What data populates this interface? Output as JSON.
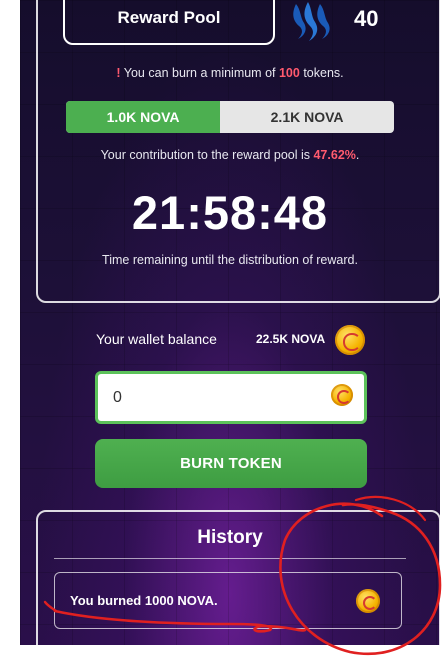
{
  "reward_pool": {
    "label": "Reward Pool",
    "count": "40"
  },
  "minimum_note": {
    "prefix": "!",
    "before": " You can burn a minimum of ",
    "amount": "100",
    "after": " tokens."
  },
  "split": {
    "left_label": "1.0K NOVA",
    "right_label": "2.1K NOVA",
    "left_fraction": 0.47
  },
  "contribution": {
    "text": "Your contribution to the reward pool is ",
    "percent": "47.62%",
    "suffix": "."
  },
  "timer": {
    "value": "21:58:48",
    "label": "Time remaining until the distribution of reward."
  },
  "wallet": {
    "label": "Your wallet balance",
    "value": "22.5K NOVA",
    "icon": "nova-coin-icon"
  },
  "input": {
    "value": "0"
  },
  "burn_button": {
    "label": "BURN TOKEN"
  },
  "history": {
    "title": "History",
    "items": [
      {
        "text": "You burned 1000 NOVA."
      }
    ]
  },
  "colors": {
    "accent_red": "#ff5a6e",
    "green": "#4caf50",
    "steem_blue": "#1a5bb8",
    "coin_gold": "#f5b400",
    "annotation_red": "#e02020"
  }
}
